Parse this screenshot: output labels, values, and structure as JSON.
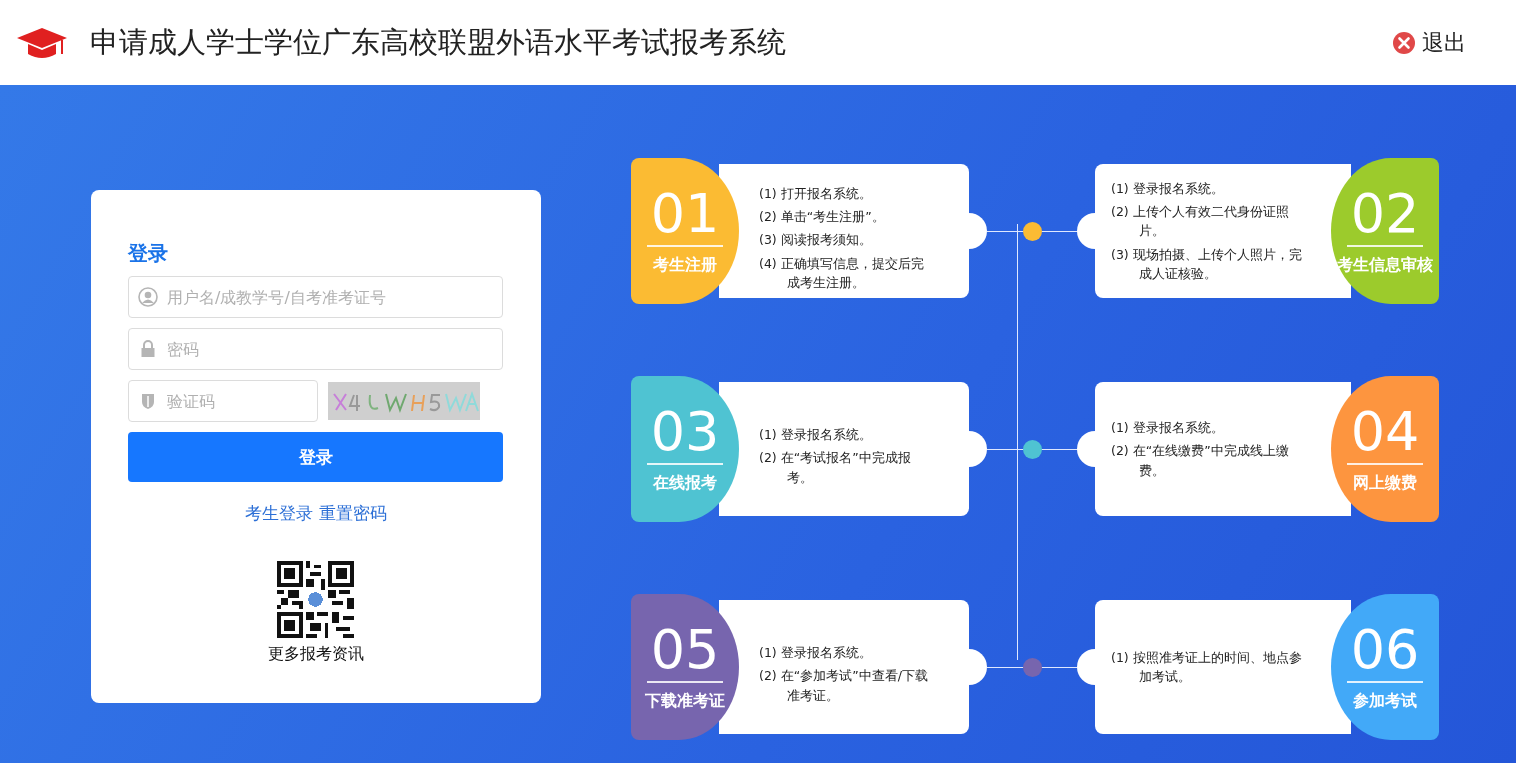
{
  "header": {
    "title": "申请成人学士学位广东高校联盟外语水平考试报考系统",
    "logout": "退出"
  },
  "login": {
    "title": "登录",
    "username": {
      "placeholder": "用户名/成教学号/自考准考证号"
    },
    "password": {
      "placeholder": "密码"
    },
    "captcha": {
      "placeholder": "验证码"
    },
    "submit": "登录",
    "links": [
      "考生登录",
      "重置密码"
    ],
    "qr_caption": "更多报考资讯"
  },
  "steps": [
    {
      "number": "01",
      "title": "考生注册",
      "color": "#fbbb33",
      "lines": [
        "(1) 打开报名系统。",
        "(2) 单击“考生注册”。",
        "(3) 阅读报考须知。",
        "(4) 正确填写信息，提交后完成考生注册。"
      ]
    },
    {
      "number": "02",
      "title": "考生信息审核",
      "color": "#9ccb2c",
      "lines": [
        "(1) 登录报名系统。",
        "(2) 上传个人有效二代身份证照片。",
        "(3) 现场拍摄、上传个人照片，完成人证核验。"
      ]
    },
    {
      "number": "03",
      "title": "在线报考",
      "color": "#4fc3d2",
      "lines": [
        "(1)  登录报名系统。",
        "(2)  在“考试报名”中完成报考。"
      ]
    },
    {
      "number": "04",
      "title": "网上缴费",
      "color": "#fd953f",
      "lines": [
        "(1) 登录报名系统。",
        "(2) 在“在线缴费”中完成线上缴费。"
      ]
    },
    {
      "number": "05",
      "title": "下载准考证",
      "color": "#7765ae",
      "lines": [
        "(1) 登录报名系统。",
        "(2) 在“参加考试”中查看/下载准考证。"
      ]
    },
    {
      "number": "06",
      "title": "参加考试",
      "color": "#42a9f8",
      "lines": [
        "(1) 按照准考证上的时间、地点参加考试。"
      ]
    }
  ]
}
